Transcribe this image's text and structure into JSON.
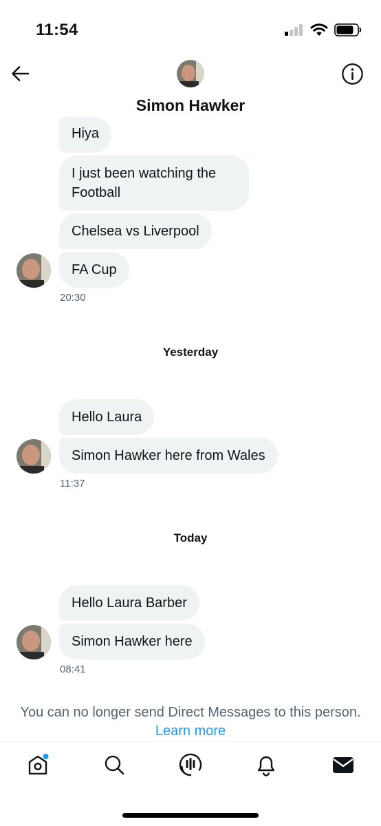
{
  "status_bar": {
    "time": "11:54"
  },
  "header": {
    "name": "Simon Hawker"
  },
  "messages": [
    "Hiya",
    "I just been watching the Football",
    "Chelsea vs Liverpool",
    "FA Cup",
    "Hello Laura",
    "Simon Hawker here from Wales",
    "Hello Laura Barber",
    "Simon Hawker here"
  ],
  "timestamps": [
    "20:30",
    "11:37",
    "08:41"
  ],
  "dividers": {
    "yesterday": "Yesterday",
    "today": "Today"
  },
  "notice": {
    "text": "You can no longer send Direct Messages to this person.",
    "link": "Learn more"
  },
  "icons": [
    "back-arrow-icon",
    "info-icon",
    "home-icon",
    "search-icon",
    "spaces-icon",
    "notifications-icon",
    "messages-icon"
  ],
  "colors": {
    "accent": "#1d9bf0",
    "bubble": "#eff3f4",
    "secondary_text": "#536471"
  }
}
